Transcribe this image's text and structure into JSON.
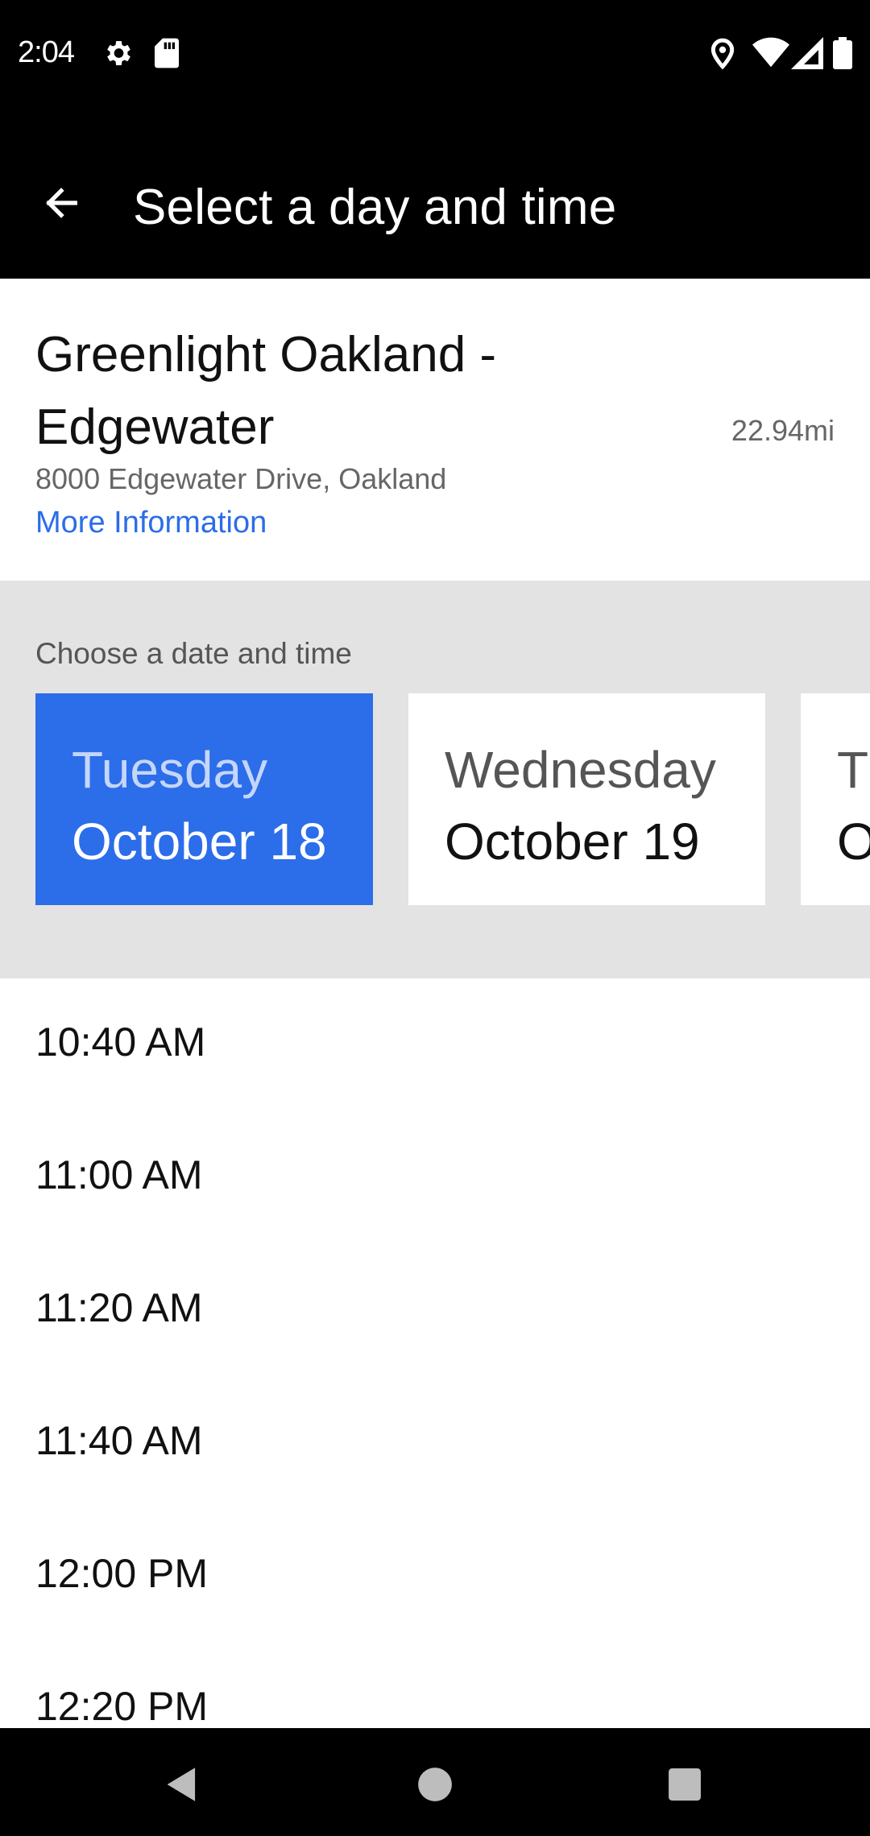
{
  "status_bar": {
    "time": "2:04",
    "icons": [
      "gear-icon",
      "sd-card-icon",
      "location-pin-icon",
      "wifi-icon",
      "signal-icon",
      "battery-icon"
    ]
  },
  "app_bar": {
    "title": "Select a day and time",
    "back_icon": "arrow-left-icon"
  },
  "location": {
    "name": "Greenlight Oakland - Edgewater",
    "distance": "22.94mi",
    "address": "8000 Edgewater Drive, Oakland",
    "more_info": "More Information"
  },
  "date_picker": {
    "heading": "Choose a date and time",
    "dates": [
      {
        "day": "Tuesday",
        "date": "October 18",
        "selected": true
      },
      {
        "day": "Wednesday",
        "date": "October 19",
        "selected": false
      },
      {
        "day": "T",
        "date": "O",
        "selected": false
      }
    ]
  },
  "time_slots": [
    "10:40 AM",
    "11:00 AM",
    "11:20 AM",
    "11:40 AM",
    "12:00 PM",
    "12:20 PM"
  ],
  "nav_bar": {
    "buttons": [
      "back-triangle-icon",
      "home-circle-icon",
      "recents-square-icon"
    ]
  },
  "colors": {
    "accent": "#2c6de9",
    "link": "#2b6de9",
    "section_bg": "#e3e3e3"
  }
}
